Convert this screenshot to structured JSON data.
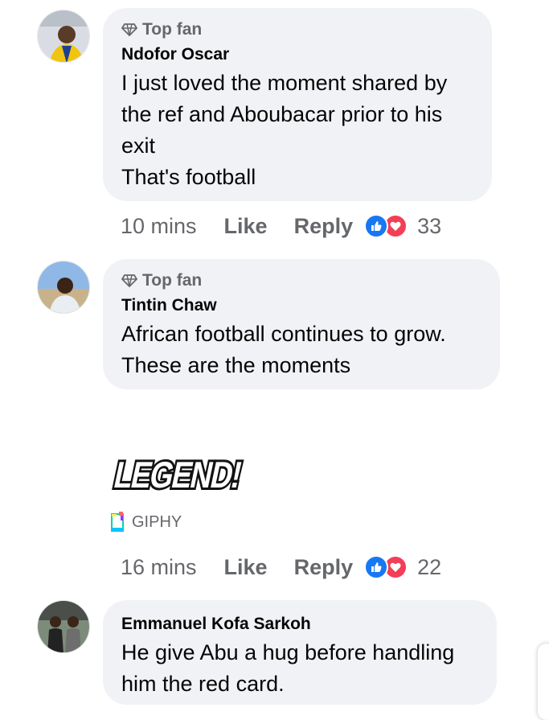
{
  "comments": [
    {
      "badge": "Top fan",
      "author": "Ndofor Oscar",
      "lines": [
        "I just loved the moment shared by",
        "the ref and Aboubacar prior to his",
        "exit",
        "That's football"
      ],
      "time": "10 mins",
      "like_label": "Like",
      "reply_label": "Reply",
      "reaction_count": "33"
    },
    {
      "badge": "Top fan",
      "author": "Tintin Chaw",
      "lines": [
        "African football continues to grow.",
        "These are the moments"
      ],
      "gif_text": "LEGEND!",
      "gif_source": "GIPHY",
      "time": "16 mins",
      "like_label": "Like",
      "reply_label": "Reply",
      "reaction_count": "22"
    },
    {
      "author": "Emmanuel Kofa Sarkoh",
      "lines": [
        "He give Abu a hug before handling",
        "him the red card."
      ]
    }
  ],
  "icons": {
    "badge": "top-fan-diamond-icon",
    "reactions": [
      "like-reaction-icon",
      "love-reaction-icon"
    ],
    "giphy": "giphy-logo-icon"
  },
  "colors": {
    "bubble": "#f0f2f5",
    "secondary_text": "#65676b",
    "like_blue": "#1877f2",
    "love_red": "#f33e58"
  }
}
